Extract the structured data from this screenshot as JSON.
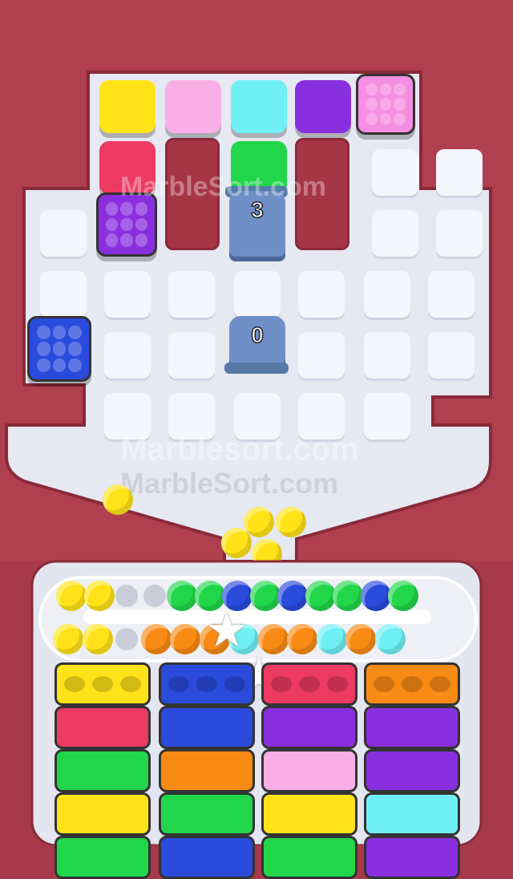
{
  "watermarks": {
    "top": "MarbleSort.com",
    "middle": "Marblesort.com",
    "bottom": "MarbleSort.com"
  },
  "spawners": [
    {
      "id": "spawner-1",
      "count": "3"
    },
    {
      "id": "spawner-2",
      "count": "0"
    }
  ],
  "colors": {
    "yellow": "#ffe318",
    "pink": "#f9aee6",
    "cyan": "#6ff0f4",
    "purple": "#8a2fe0",
    "red": "#ec3a63",
    "green": "#22d64a",
    "blue": "#2a4bdc",
    "orange": "#f98a13",
    "board_frame": "#b0404f",
    "floor": "#e6e8f2"
  },
  "board_blocks": [
    {
      "color": "yellow"
    },
    {
      "color": "pink"
    },
    {
      "color": "cyan"
    },
    {
      "color": "purple"
    },
    {
      "color": "pink",
      "holes": 9
    },
    {
      "color": "red"
    },
    {
      "color": "green"
    },
    {
      "color": "purple",
      "holes": 9
    },
    {
      "color": "blue",
      "holes": 9
    }
  ],
  "conveyor": {
    "top_row": [
      "yellow",
      "yellow",
      "empty",
      "empty",
      "green",
      "green",
      "blue",
      "green",
      "blue",
      "green",
      "green",
      "blue",
      "green"
    ],
    "bottom_row": [
      "yellow",
      "yellow",
      "empty",
      "orange",
      "orange",
      "orange",
      "cyan",
      "orange",
      "orange",
      "cyan",
      "orange",
      "cyan"
    ],
    "falling": [
      "yellow",
      "yellow",
      "yellow",
      "yellow",
      "yellow"
    ]
  },
  "trays": [
    [
      "yellow",
      "red",
      "green",
      "yellow",
      "green"
    ],
    [
      "blue",
      "blue",
      "orange",
      "green",
      "blue"
    ],
    [
      "red",
      "purple",
      "pink",
      "yellow",
      "green"
    ],
    [
      "orange",
      "purple",
      "purple",
      "cyan",
      "purple"
    ]
  ]
}
